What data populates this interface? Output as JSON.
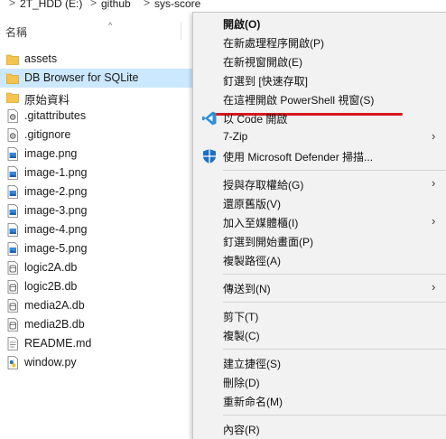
{
  "breadcrumb": {
    "items": [
      "2T_HDD (E:)",
      "github",
      "sys-score"
    ],
    "separator": ">"
  },
  "column_header": {
    "name_label": "名稱",
    "sort_indicator": "^"
  },
  "files": [
    {
      "name": "assets",
      "icon": "folder-icon",
      "selected": false
    },
    {
      "name": "DB Browser for SQLite",
      "icon": "folder-icon",
      "selected": true
    },
    {
      "name": "原始資料",
      "icon": "folder-icon",
      "selected": false
    },
    {
      "name": ".gitattributes",
      "icon": "settings-file-icon",
      "selected": false
    },
    {
      "name": ".gitignore",
      "icon": "settings-file-icon",
      "selected": false
    },
    {
      "name": "image.png",
      "icon": "image-file-icon",
      "selected": false
    },
    {
      "name": "image-1.png",
      "icon": "image-file-icon",
      "selected": false
    },
    {
      "name": "image-2.png",
      "icon": "image-file-icon",
      "selected": false
    },
    {
      "name": "image-3.png",
      "icon": "image-file-icon",
      "selected": false
    },
    {
      "name": "image-4.png",
      "icon": "image-file-icon",
      "selected": false
    },
    {
      "name": "image-5.png",
      "icon": "image-file-icon",
      "selected": false
    },
    {
      "name": "logic2A.db",
      "icon": "db-file-icon",
      "selected": false
    },
    {
      "name": "logic2B.db",
      "icon": "db-file-icon",
      "selected": false
    },
    {
      "name": "media2A.db",
      "icon": "db-file-icon",
      "selected": false
    },
    {
      "name": "media2B.db",
      "icon": "db-file-icon",
      "selected": false
    },
    {
      "name": "README.md",
      "icon": "text-file-icon",
      "selected": false
    },
    {
      "name": "window.py",
      "icon": "python-file-icon",
      "selected": false
    }
  ],
  "context_menu": {
    "items": [
      {
        "label": "開啟(O)",
        "bold": true
      },
      {
        "label": "在新處理程序開啟(P)"
      },
      {
        "label": "在新視窗開啟(E)"
      },
      {
        "label": "釘選到 [快速存取]"
      },
      {
        "label": "在這裡開啟 PowerShell 視窗(S)",
        "highlighted": true
      },
      {
        "label": "以 Code 開啟",
        "icon": "vscode-icon"
      },
      {
        "label": "7-Zip",
        "submenu": true
      },
      {
        "label": "使用 Microsoft Defender 掃描...",
        "icon": "defender-shield-icon"
      },
      {
        "separator": true
      },
      {
        "label": "授與存取權給(G)",
        "submenu": true
      },
      {
        "label": "還原舊版(V)"
      },
      {
        "label": "加入至媒體櫃(I)",
        "submenu": true
      },
      {
        "label": "釘選到開始畫面(P)"
      },
      {
        "label": "複製路徑(A)"
      },
      {
        "separator": true
      },
      {
        "label": "傳送到(N)",
        "submenu": true
      },
      {
        "separator": true
      },
      {
        "label": "剪下(T)"
      },
      {
        "label": "複製(C)"
      },
      {
        "separator": true
      },
      {
        "label": "建立捷徑(S)"
      },
      {
        "label": "刪除(D)"
      },
      {
        "label": "重新命名(M)"
      },
      {
        "separator": true
      },
      {
        "label": "內容(R)"
      }
    ],
    "submenu_arrow": "›"
  },
  "colors": {
    "selection": "#cce8ff",
    "menu_bg": "#f2f2f2",
    "annotation_underline": "#d6171d",
    "folder": "#f4c44e",
    "vscode": "#2e8fd8",
    "defender": "#1b6fcb"
  }
}
